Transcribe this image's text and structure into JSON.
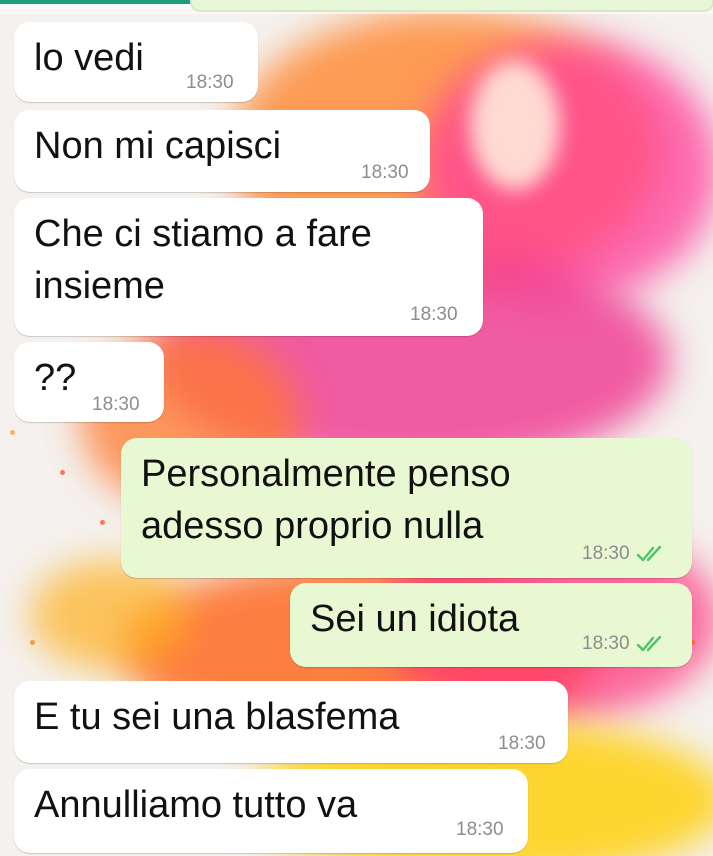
{
  "messages": [
    {
      "direction": "incoming",
      "text": "lo vedi",
      "time": "18:30"
    },
    {
      "direction": "incoming",
      "text": "Non mi capisci",
      "time": "18:30"
    },
    {
      "direction": "incoming",
      "text": "Che ci stiamo a fare\ninsieme",
      "time": "18:30"
    },
    {
      "direction": "incoming",
      "text": "??",
      "time": "18:30"
    },
    {
      "direction": "outgoing",
      "text": "Personalmente penso\nadesso proprio nulla",
      "time": "18:30",
      "status": "read-double-check-icon"
    },
    {
      "direction": "outgoing",
      "text": "Sei un idiota",
      "time": "18:30",
      "status": "read-double-check-icon"
    },
    {
      "direction": "incoming",
      "text": "E tu sei una blasfema",
      "time": "18:30"
    },
    {
      "direction": "incoming",
      "text": "Annulliamo tutto va",
      "time": "18:30"
    }
  ],
  "colors": {
    "incoming_bubble": "#ffffff",
    "outgoing_bubble": "#e7f8d2",
    "read_check": "#4fc36b",
    "timestamp": "#8d8d8d"
  }
}
